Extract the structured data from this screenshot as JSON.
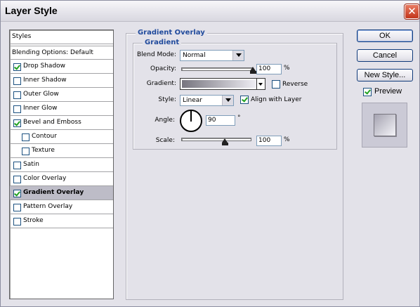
{
  "window": {
    "title": "Layer Style",
    "close_glyph": "✕"
  },
  "styles_list": {
    "header": "Styles",
    "blending_options": "Blending Options: Default",
    "items": [
      {
        "label": "Drop Shadow",
        "checked": true,
        "indent": false,
        "selected": false
      },
      {
        "label": "Inner Shadow",
        "checked": false,
        "indent": false,
        "selected": false
      },
      {
        "label": "Outer Glow",
        "checked": false,
        "indent": false,
        "selected": false
      },
      {
        "label": "Inner Glow",
        "checked": false,
        "indent": false,
        "selected": false
      },
      {
        "label": "Bevel and Emboss",
        "checked": true,
        "indent": false,
        "selected": false
      },
      {
        "label": "Contour",
        "checked": false,
        "indent": true,
        "selected": false
      },
      {
        "label": "Texture",
        "checked": false,
        "indent": true,
        "selected": false
      },
      {
        "label": "Satin",
        "checked": false,
        "indent": false,
        "selected": false
      },
      {
        "label": "Color Overlay",
        "checked": false,
        "indent": false,
        "selected": false
      },
      {
        "label": "Gradient Overlay",
        "checked": true,
        "indent": false,
        "selected": true
      },
      {
        "label": "Pattern Overlay",
        "checked": false,
        "indent": false,
        "selected": false
      },
      {
        "label": "Stroke",
        "checked": false,
        "indent": false,
        "selected": false
      }
    ]
  },
  "panel": {
    "section_title": "Gradient Overlay",
    "group_title": "Gradient",
    "blend_mode_label": "Blend Mode:",
    "blend_mode_value": "Normal",
    "opacity_label": "Opacity:",
    "opacity_value": "100",
    "opacity_unit": "%",
    "opacity_percent": 100,
    "gradient_label": "Gradient:",
    "reverse_label": "Reverse",
    "reverse_checked": false,
    "style_label": "Style:",
    "style_value": "Linear",
    "align_label": "Align with Layer",
    "align_checked": true,
    "angle_label": "Angle:",
    "angle_value": "90",
    "angle_unit": "°",
    "scale_label": "Scale:",
    "scale_value": "100",
    "scale_unit": "%",
    "scale_percent": 100
  },
  "buttons": {
    "ok": "OK",
    "cancel": "Cancel",
    "new_style": "New Style..."
  },
  "preview": {
    "label": "Preview",
    "checked": true
  },
  "colors": {
    "accent_title": "#204a9c",
    "selected_row": "#bdbcc7",
    "checkmark": "#21a121"
  }
}
